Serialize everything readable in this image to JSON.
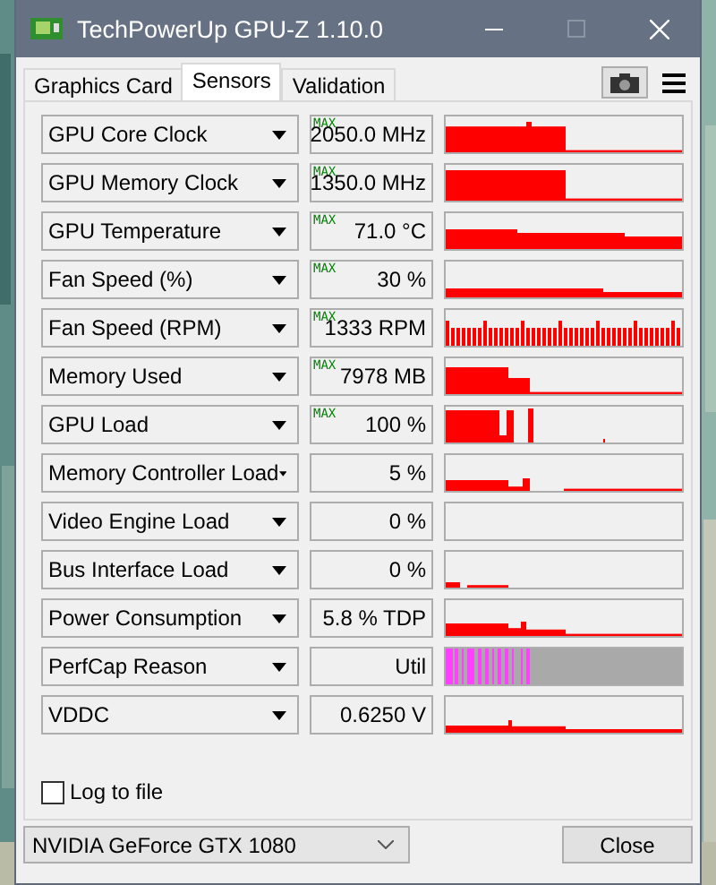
{
  "window": {
    "title": "TechPowerUp GPU-Z 1.10.0"
  },
  "tabs": [
    {
      "label": "Graphics Card",
      "selected": false
    },
    {
      "label": "Sensors",
      "selected": true
    },
    {
      "label": "Validation",
      "selected": false
    }
  ],
  "sensors": [
    {
      "name": "GPU Core Clock",
      "value": "2050.0 MHz",
      "max_label": "MAX"
    },
    {
      "name": "GPU Memory Clock",
      "value": "1350.0 MHz",
      "max_label": "MAX"
    },
    {
      "name": "GPU Temperature",
      "value": "71.0 °C",
      "max_label": "MAX"
    },
    {
      "name": "Fan Speed (%)",
      "value": "30 %",
      "max_label": "MAX"
    },
    {
      "name": "Fan Speed (RPM)",
      "value": "1333 RPM",
      "max_label": "MAX"
    },
    {
      "name": "Memory Used",
      "value": "7978 MB",
      "max_label": "MAX"
    },
    {
      "name": "GPU Load",
      "value": "100 %",
      "max_label": "MAX"
    },
    {
      "name": "Memory Controller Load",
      "value": "5 %"
    },
    {
      "name": "Video Engine Load",
      "value": "0 %"
    },
    {
      "name": "Bus Interface Load",
      "value": "0 %"
    },
    {
      "name": "Power Consumption",
      "value": "5.8 % TDP"
    },
    {
      "name": "PerfCap Reason",
      "value": "Util"
    },
    {
      "name": "VDDC",
      "value": "0.6250 V"
    }
  ],
  "log_to_file": {
    "label": "Log to file",
    "checked": false
  },
  "device": {
    "value": "NVIDIA GeForce GTX 1080"
  },
  "close_button": "Close"
}
